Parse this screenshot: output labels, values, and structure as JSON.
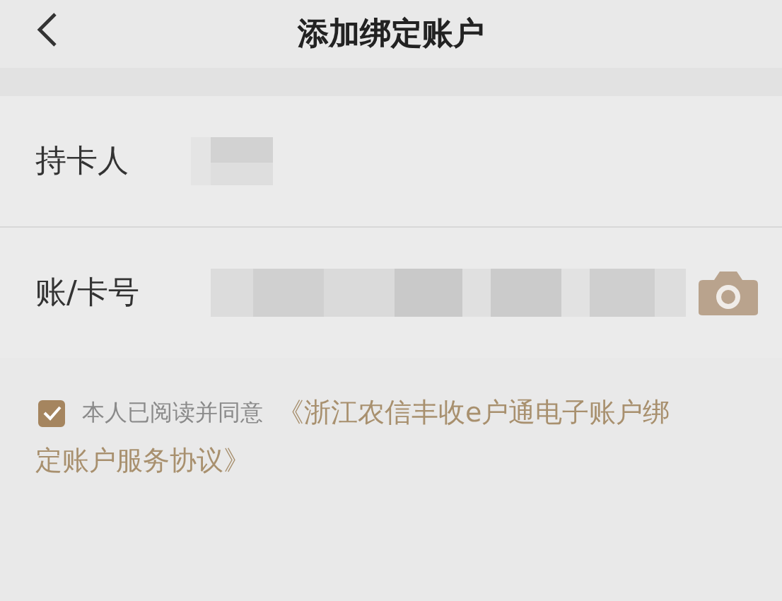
{
  "header": {
    "title": "添加绑定账户"
  },
  "fields": [
    {
      "label": "持卡人",
      "masked": true,
      "kind": "name"
    },
    {
      "label": "账/卡号",
      "masked": true,
      "kind": "card"
    }
  ],
  "agreement": {
    "checked": true,
    "text": "本人已阅读并同意",
    "link_lines": [
      "《浙江农信丰收e户通电子账户绑",
      "定账户服务协议》"
    ]
  }
}
